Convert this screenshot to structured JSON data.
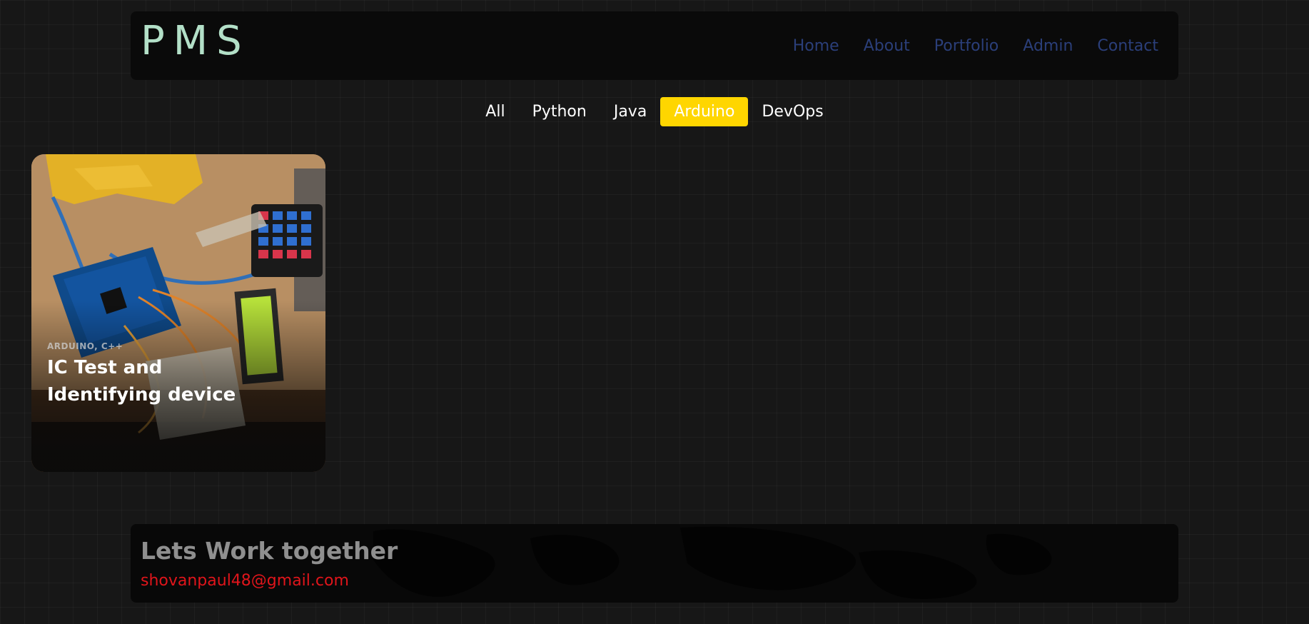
{
  "header": {
    "logo": "PMS",
    "nav": [
      {
        "label": "Home"
      },
      {
        "label": "About"
      },
      {
        "label": "Portfolio"
      },
      {
        "label": "Admin"
      },
      {
        "label": "Contact"
      }
    ]
  },
  "filters": {
    "items": [
      {
        "label": "All"
      },
      {
        "label": "Python"
      },
      {
        "label": "Java"
      },
      {
        "label": "Arduino"
      },
      {
        "label": "DevOps"
      }
    ],
    "selected": "Arduino"
  },
  "projects": [
    {
      "tags": "ARDUINO, C++",
      "title": "IC Test and Identifying device",
      "image_icon": "arduino-circuit-photo"
    }
  ],
  "footer": {
    "heading": "Lets Work together",
    "email": "shovanpaul48@gmail.com"
  },
  "colors": {
    "background": "#171717",
    "logo": "#b3e0c8",
    "nav_link": "#2b3f7a",
    "active_filter": "#ffd600",
    "email": "#e0151b"
  }
}
